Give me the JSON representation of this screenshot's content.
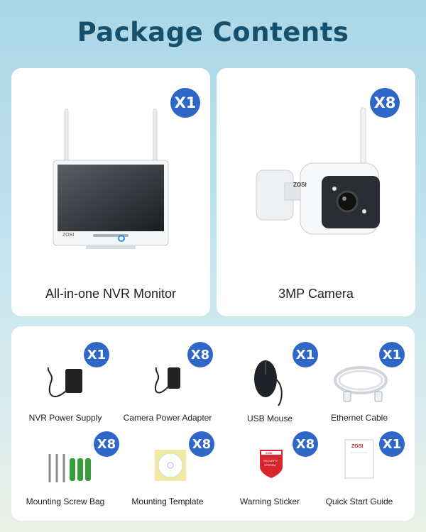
{
  "title": "Package Contents",
  "main_items": [
    {
      "label": "All-in-one NVR Monitor",
      "qty": "X1",
      "icon": "nvr-monitor"
    },
    {
      "label": "3MP Camera",
      "qty": "X8",
      "icon": "security-camera"
    }
  ],
  "accessories": [
    {
      "label": "NVR Power Supply",
      "qty": "X1",
      "icon": "power-adapter"
    },
    {
      "label": "Camera Power Adapter",
      "qty": "X8",
      "icon": "power-adapter"
    },
    {
      "label": "USB Mouse",
      "qty": "X1",
      "icon": "mouse"
    },
    {
      "label": "Ethernet Cable",
      "qty": "X1",
      "icon": "ethernet-cable"
    },
    {
      "label": "Mounting Screw Bag",
      "qty": "X8",
      "icon": "screws"
    },
    {
      "label": "Mounting Template",
      "qty": "X8",
      "icon": "template"
    },
    {
      "label": "Warning Sticker",
      "qty": "X8",
      "icon": "sticker"
    },
    {
      "label": "Quick Start Guide",
      "qty": "X1",
      "icon": "guide"
    }
  ],
  "brand": "ZOSI",
  "sticker_text": [
    "SECURITY",
    "SYSTEM"
  ],
  "colors": {
    "badge": "#2f67c9",
    "title": "#17506a"
  }
}
